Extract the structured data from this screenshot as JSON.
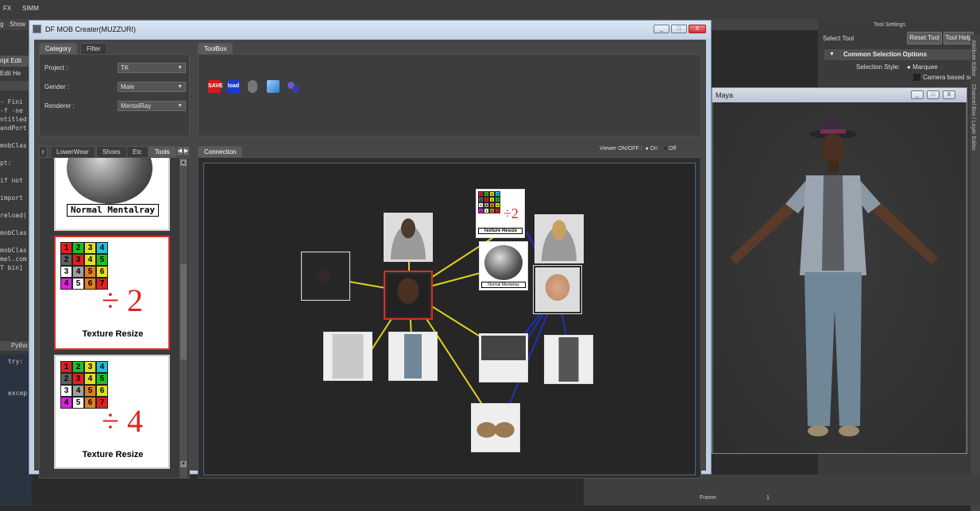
{
  "maya": {
    "shelf_tabs": [
      "FX",
      "SIMM"
    ],
    "menu_left": [
      "g",
      "Show"
    ],
    "script_editor": {
      "title_fragment": "ript Edit",
      "menu": [
        "Edit",
        "He"
      ],
      "lines": [
        "-  Fini",
        "-f -ne",
        "ntitled",
        "andPort",
        "",
        "mobClas",
        "",
        "pt:",
        "",
        "if not",
        "",
        "import",
        "",
        "reload(",
        "",
        "mobClas",
        "",
        "mobClas",
        "mel.com",
        "T bin]"
      ],
      "tab_label": "Pytho",
      "lower_lines": [
        "try:",
        "",
        "excep"
      ]
    },
    "tool_settings": {
      "title": "Tool Settings",
      "select_tool": "Select Tool",
      "reset_btn": "Reset Tool",
      "help_btn": "Tool Help",
      "section": "Common Selection Options",
      "selection_style_label": "Selection Style:",
      "selection_style_value": "Marquee",
      "camera_option": "Camera based se"
    },
    "side_tabs": [
      "Attribute Editor",
      "Channel Box / Layer Editor"
    ],
    "bottom": {
      "frame_label": "Frame:",
      "frame_value": "1"
    }
  },
  "viewport": {
    "title": "Maya",
    "buttons": [
      "_",
      "□",
      "X"
    ]
  },
  "main_window": {
    "title": "DF MOB Creater(MUZZURI)",
    "buttons": [
      "_",
      "□",
      "X"
    ],
    "tabs": [
      "Category",
      "Filter"
    ],
    "fields": [
      {
        "label": "Project :",
        "value": "TK"
      },
      {
        "label": "Gender :",
        "value": "Male"
      },
      {
        "label": "Renderer :",
        "value": "MentalRay"
      }
    ],
    "toolbox_tab": "ToolBox",
    "toolbox_icons": [
      {
        "name": "save-icon",
        "label": "SAVE",
        "color": "#d81a1a"
      },
      {
        "name": "load-icon",
        "label": "load",
        "color": "#1a3ad8"
      },
      {
        "name": "sound-icon",
        "label": "",
        "color": "#666666"
      },
      {
        "name": "cube-icon",
        "label": "",
        "color": "#4aa0e8"
      },
      {
        "name": "spheres-icon",
        "label": "",
        "color": "#5a5ad8"
      }
    ],
    "asset_tabs": [
      "r",
      "LowerWear",
      "Shoes",
      "Etc",
      "Tools"
    ],
    "tool_cards": [
      {
        "caption": "Normal Mentalray"
      },
      {
        "caption": "Texture Resize",
        "divisor": "÷ 2",
        "grid": [
          "1",
          "2",
          "3",
          "4",
          "2",
          "3",
          "4",
          "5",
          "3",
          "4",
          "5",
          "6",
          "4",
          "5",
          "6",
          "7"
        ]
      },
      {
        "caption": "Texture Resize",
        "divisor": "÷ 4",
        "grid": [
          "1",
          "2",
          "3",
          "4",
          "2",
          "3",
          "4",
          "5",
          "3",
          "4",
          "5",
          "6",
          "4",
          "5",
          "6",
          "7"
        ]
      }
    ],
    "connection_tab": "Connection",
    "viewer_label": "Viewer ON/OFF :",
    "viewer_on": "On",
    "viewer_off": "Off",
    "connection_tile_caption": "Texture Resize",
    "connection_tile_divisor": "÷2",
    "sphere_tile_caption": "Normal Mentalray"
  },
  "colors": {
    "link_yellow": "#e0d020",
    "link_blue": "#2030c0",
    "selection_red": "#d63020"
  }
}
